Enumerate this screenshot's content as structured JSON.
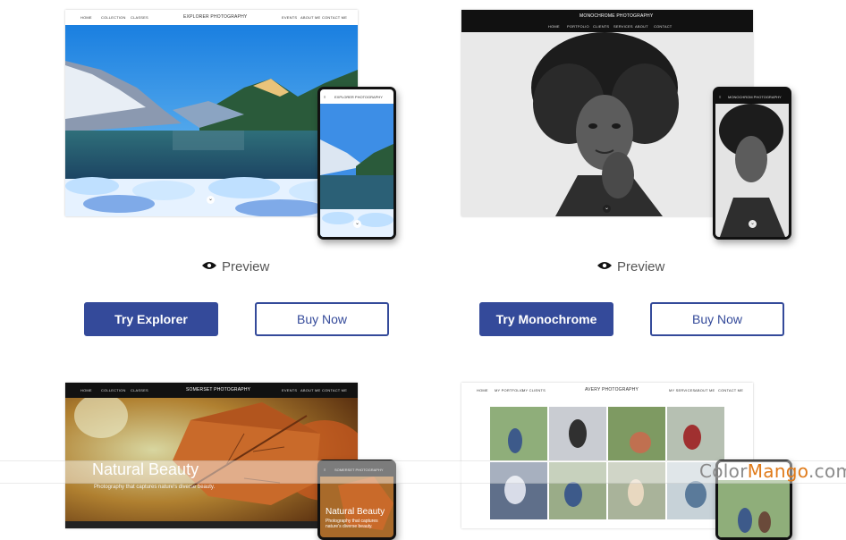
{
  "cards": [
    {
      "nav": [
        "HOME",
        "COLLECTION",
        "CLASSES",
        "EVENTS",
        "ABOUT ME",
        "CONTACT ME"
      ],
      "brand": "EXPLORER PHOTOGRAPHY",
      "phone_brand": "EXPLORER PHOTOGRAPHY",
      "preview": "Preview",
      "try_label": "Try Explorer",
      "buy_label": "Buy Now"
    },
    {
      "brand": "MONOCHROME PHOTOGRAPHY",
      "nav": [
        "HOME",
        "PORTFOLIO",
        "CLIENTS",
        "SERVICES",
        "ABOUT",
        "CONTACT"
      ],
      "phone_brand": "MONOCHROM PHOTOGRAPHY",
      "preview": "Preview",
      "try_label": "Try Monochrome",
      "buy_label": "Buy Now"
    },
    {
      "nav": [
        "HOME",
        "COLLECTION",
        "CLASSES",
        "EVENTS",
        "ABOUT ME",
        "CONTACT ME"
      ],
      "brand": "SOMERSET PHOTOGRAPHY",
      "phone_brand": "SOMERSET PHOTOGRAPHY",
      "headline": "Natural Beauty",
      "tagline": "Photography that captures nature's diverse beauty.",
      "phone_headline": "Natural Beauty",
      "phone_tagline": "Photography that captures nature's diverse beauty."
    },
    {
      "nav": [
        "HOME",
        "MY PORTFOLIO",
        "MY CLIENTS",
        "MY SERVICES",
        "ABOUT ME",
        "CONTACT ME"
      ],
      "brand": "AVERY PHOTOGRAPHY"
    }
  ],
  "watermark": {
    "part1": "Color",
    "part2": "Mango",
    "part3": ".com"
  },
  "icons": {
    "preview": "eye-icon",
    "scroll": "chevron-down-icon",
    "menu": "menu-icon"
  }
}
